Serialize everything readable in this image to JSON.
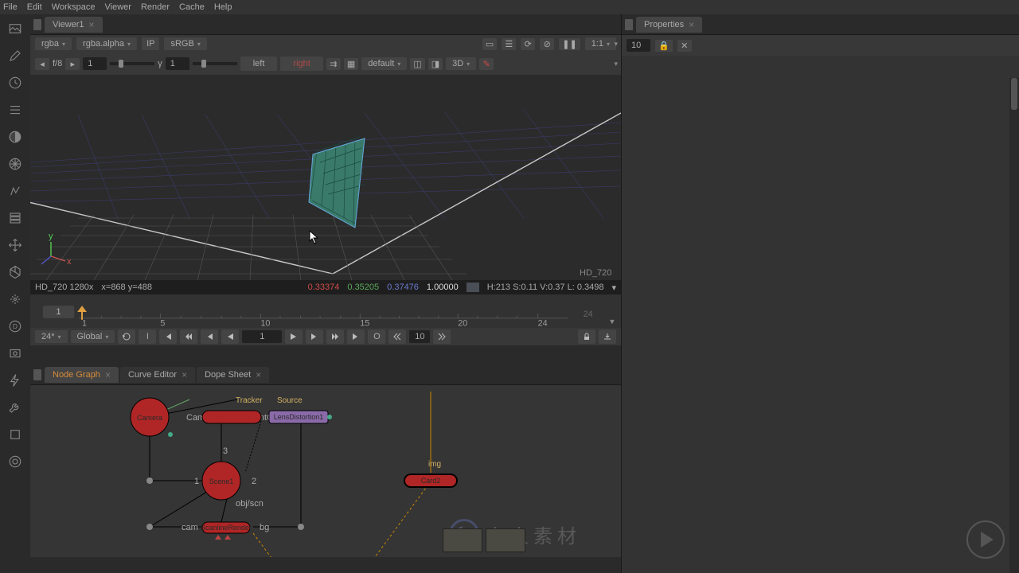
{
  "menu": {
    "items": [
      "File",
      "Edit",
      "Workspace",
      "Viewer",
      "Render",
      "Cache",
      "Help"
    ]
  },
  "left_tools": [
    "image",
    "arrow",
    "clock",
    "lines",
    "pie",
    "sphere",
    "brush",
    "layers",
    "move",
    "cube",
    "spark",
    "d",
    "anchor",
    "bolt",
    "wrench",
    "save",
    "globe"
  ],
  "viewer": {
    "tab": "Viewer1",
    "channel": "rgba",
    "alpha": "rgba.alpha",
    "ip_label": "IP",
    "colorspace": "sRGB",
    "ratio": "1:1",
    "fstop_label": "f/8",
    "fstop_val": "1",
    "gamma_label": "γ",
    "gamma_val": "1",
    "left": "left",
    "right": "right",
    "ocio": "default",
    "mode3d": "3D",
    "format_label": "HD_720",
    "resolution": "HD_720 1280x",
    "coords": "x=868 y=488",
    "rgba": {
      "r": "0.33374",
      "g": "0.35205",
      "b": "0.37476",
      "a": "1.00000"
    },
    "hsv": "H:213 S:0.11 V:0.37 L: 0.3498"
  },
  "timeline": {
    "start": "1",
    "ticks": [
      "1",
      "5",
      "10",
      "15",
      "20",
      "24"
    ],
    "end_ghost": "24",
    "current": "1",
    "fps": "24*",
    "sync": "Global",
    "frame_field": "1",
    "step_field": "10",
    "keybtn": "I",
    "outbtn": "O"
  },
  "bottom_tabs": [
    "Node Graph",
    "Curve Editor",
    "Dope Sheet"
  ],
  "nodes": {
    "tracker": "Tracker",
    "source": "Source",
    "camera": "Camera",
    "camtrack": "CameraTrackerPointCloud",
    "lens": "LensDistortion1",
    "scene": "Scene1",
    "objscn": "obj/scn",
    "cam": "cam",
    "scanline": "ScanlineRender",
    "bg": "bg",
    "img": "img",
    "card": "Card2",
    "port1": "1",
    "port2": "2",
    "port3": "3"
  },
  "props": {
    "title": "Properties",
    "count": "10"
  },
  "watermark": "人人素材"
}
